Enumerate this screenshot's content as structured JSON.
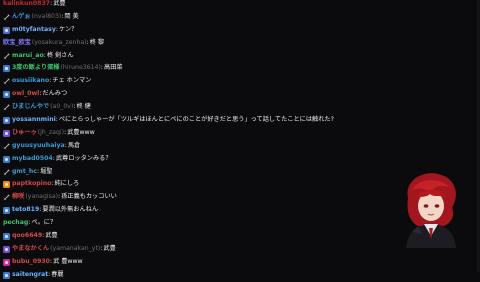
{
  "chat": {
    "messages": [
      {
        "name": "kalinkun0837",
        "handle": "",
        "text": "武豊",
        "color": "#c42b2b",
        "badge": "",
        "badge_color": "#3a7bd5"
      },
      {
        "name": "んゲぉ",
        "handle": "(nval803)",
        "text": "岡 美",
        "color": "#3a9bd6",
        "badge": "sword",
        "badge_color": "#8a8a8a"
      },
      {
        "name": "m0tyfantasy",
        "handle": "",
        "text": "ケン？",
        "color": "#6db2ff",
        "badge": "square",
        "badge_color": "#4c6fcb"
      },
      {
        "name": "欧宝_欧宝",
        "handle": "(yosakura_zenha)",
        "text": "柊 黎",
        "color": "#7f78ff",
        "badge": "",
        "badge_color": ""
      },
      {
        "name": "marui_ao",
        "handle": "",
        "text": "柊 剣さん",
        "color": "#3ec46d",
        "badge": "sword",
        "badge_color": "#8a8a8a"
      },
      {
        "name": "3度の飯より蛋様",
        "handle": "(hirune3614)",
        "text": "高田菜",
        "color": "#3ec46d",
        "badge": "square",
        "badge_color": "#3c78c8"
      },
      {
        "name": "osusiikano",
        "handle": "",
        "text": "チェ ホンマン",
        "color": "#3a9bd6",
        "badge": "sword",
        "badge_color": "#8a8a8a"
      },
      {
        "name": "owl_0wl",
        "handle": "",
        "text": "だんみつ",
        "color": "#d64848",
        "badge": "square",
        "badge_color": "#3c78c8"
      },
      {
        "name": "ひまじんやで",
        "handle": "(a0_0v)",
        "text": "柊 健",
        "color": "#3a9bd6",
        "badge": "sword",
        "badge_color": "#8a8a8a"
      },
      {
        "name": "yossannmini",
        "handle": "",
        "text": "ぺにとらっしゃーが「ツルギはほんとにペにのことが好きだと思う」って話してたことには触れた?",
        "color": "#6db2ff",
        "badge": "square",
        "badge_color": "#3c78c8"
      },
      {
        "name": "ひゅーゥ",
        "handle": "(jh_zaqi)",
        "text": "武豊www",
        "color": "#d64848",
        "badge": "square",
        "badge_color": "#6f4fd0"
      },
      {
        "name": "gyuusyuuhaiya",
        "handle": "",
        "text": "馬倉",
        "color": "#3a9bd6",
        "badge": "sword",
        "badge_color": "#8a8a8a"
      },
      {
        "name": "mybad0504",
        "handle": "",
        "text": "武尊ロッタンみる？",
        "color": "#3a9bd6",
        "badge": "square",
        "badge_color": "#3c78c8"
      },
      {
        "name": "gmt_hc",
        "handle": "",
        "text": "堀聖",
        "color": "#3a9bd6",
        "badge": "sword",
        "badge_color": "#8a8a8a"
      },
      {
        "name": "paptkopino",
        "handle": "",
        "text": "純にしろ",
        "color": "#d64848",
        "badge": "square",
        "badge_color": "#e08b1a"
      },
      {
        "name": "柳咲",
        "handle": "(yanagisa)",
        "text": "孫正義もカッコいい",
        "color": "#d64848",
        "badge": "sword",
        "badge_color": "#8a8a8a"
      },
      {
        "name": "teto819",
        "handle": "",
        "text": "要潤以外無おんねん",
        "color": "#6db2ff",
        "badge": "square",
        "badge_color": "#3c78c8"
      },
      {
        "name": "pechag",
        "handle": "",
        "text": "ペ。に？",
        "color": "#3ec46d",
        "badge": "",
        "badge_color": ""
      },
      {
        "name": "qoo6649",
        "handle": "",
        "text": "武豊",
        "color": "#d64848",
        "badge": "square",
        "badge_color": "#3c78c8"
      },
      {
        "name": "やまなかくん",
        "handle": "(yamanakan_yt)",
        "text": "武豊",
        "color": "#d64848",
        "badge": "square",
        "badge_color": "#6f4fd0"
      },
      {
        "name": "bubu_0930",
        "handle": "",
        "text": "武 豊www",
        "color": "#d64848",
        "badge": "square",
        "badge_color": "#c62d9e"
      },
      {
        "name": "saitengrat",
        "handle": "",
        "text": "春麗",
        "color": "#6db2ff",
        "badge": "square",
        "badge_color": "#3c78c8"
      }
    ]
  }
}
